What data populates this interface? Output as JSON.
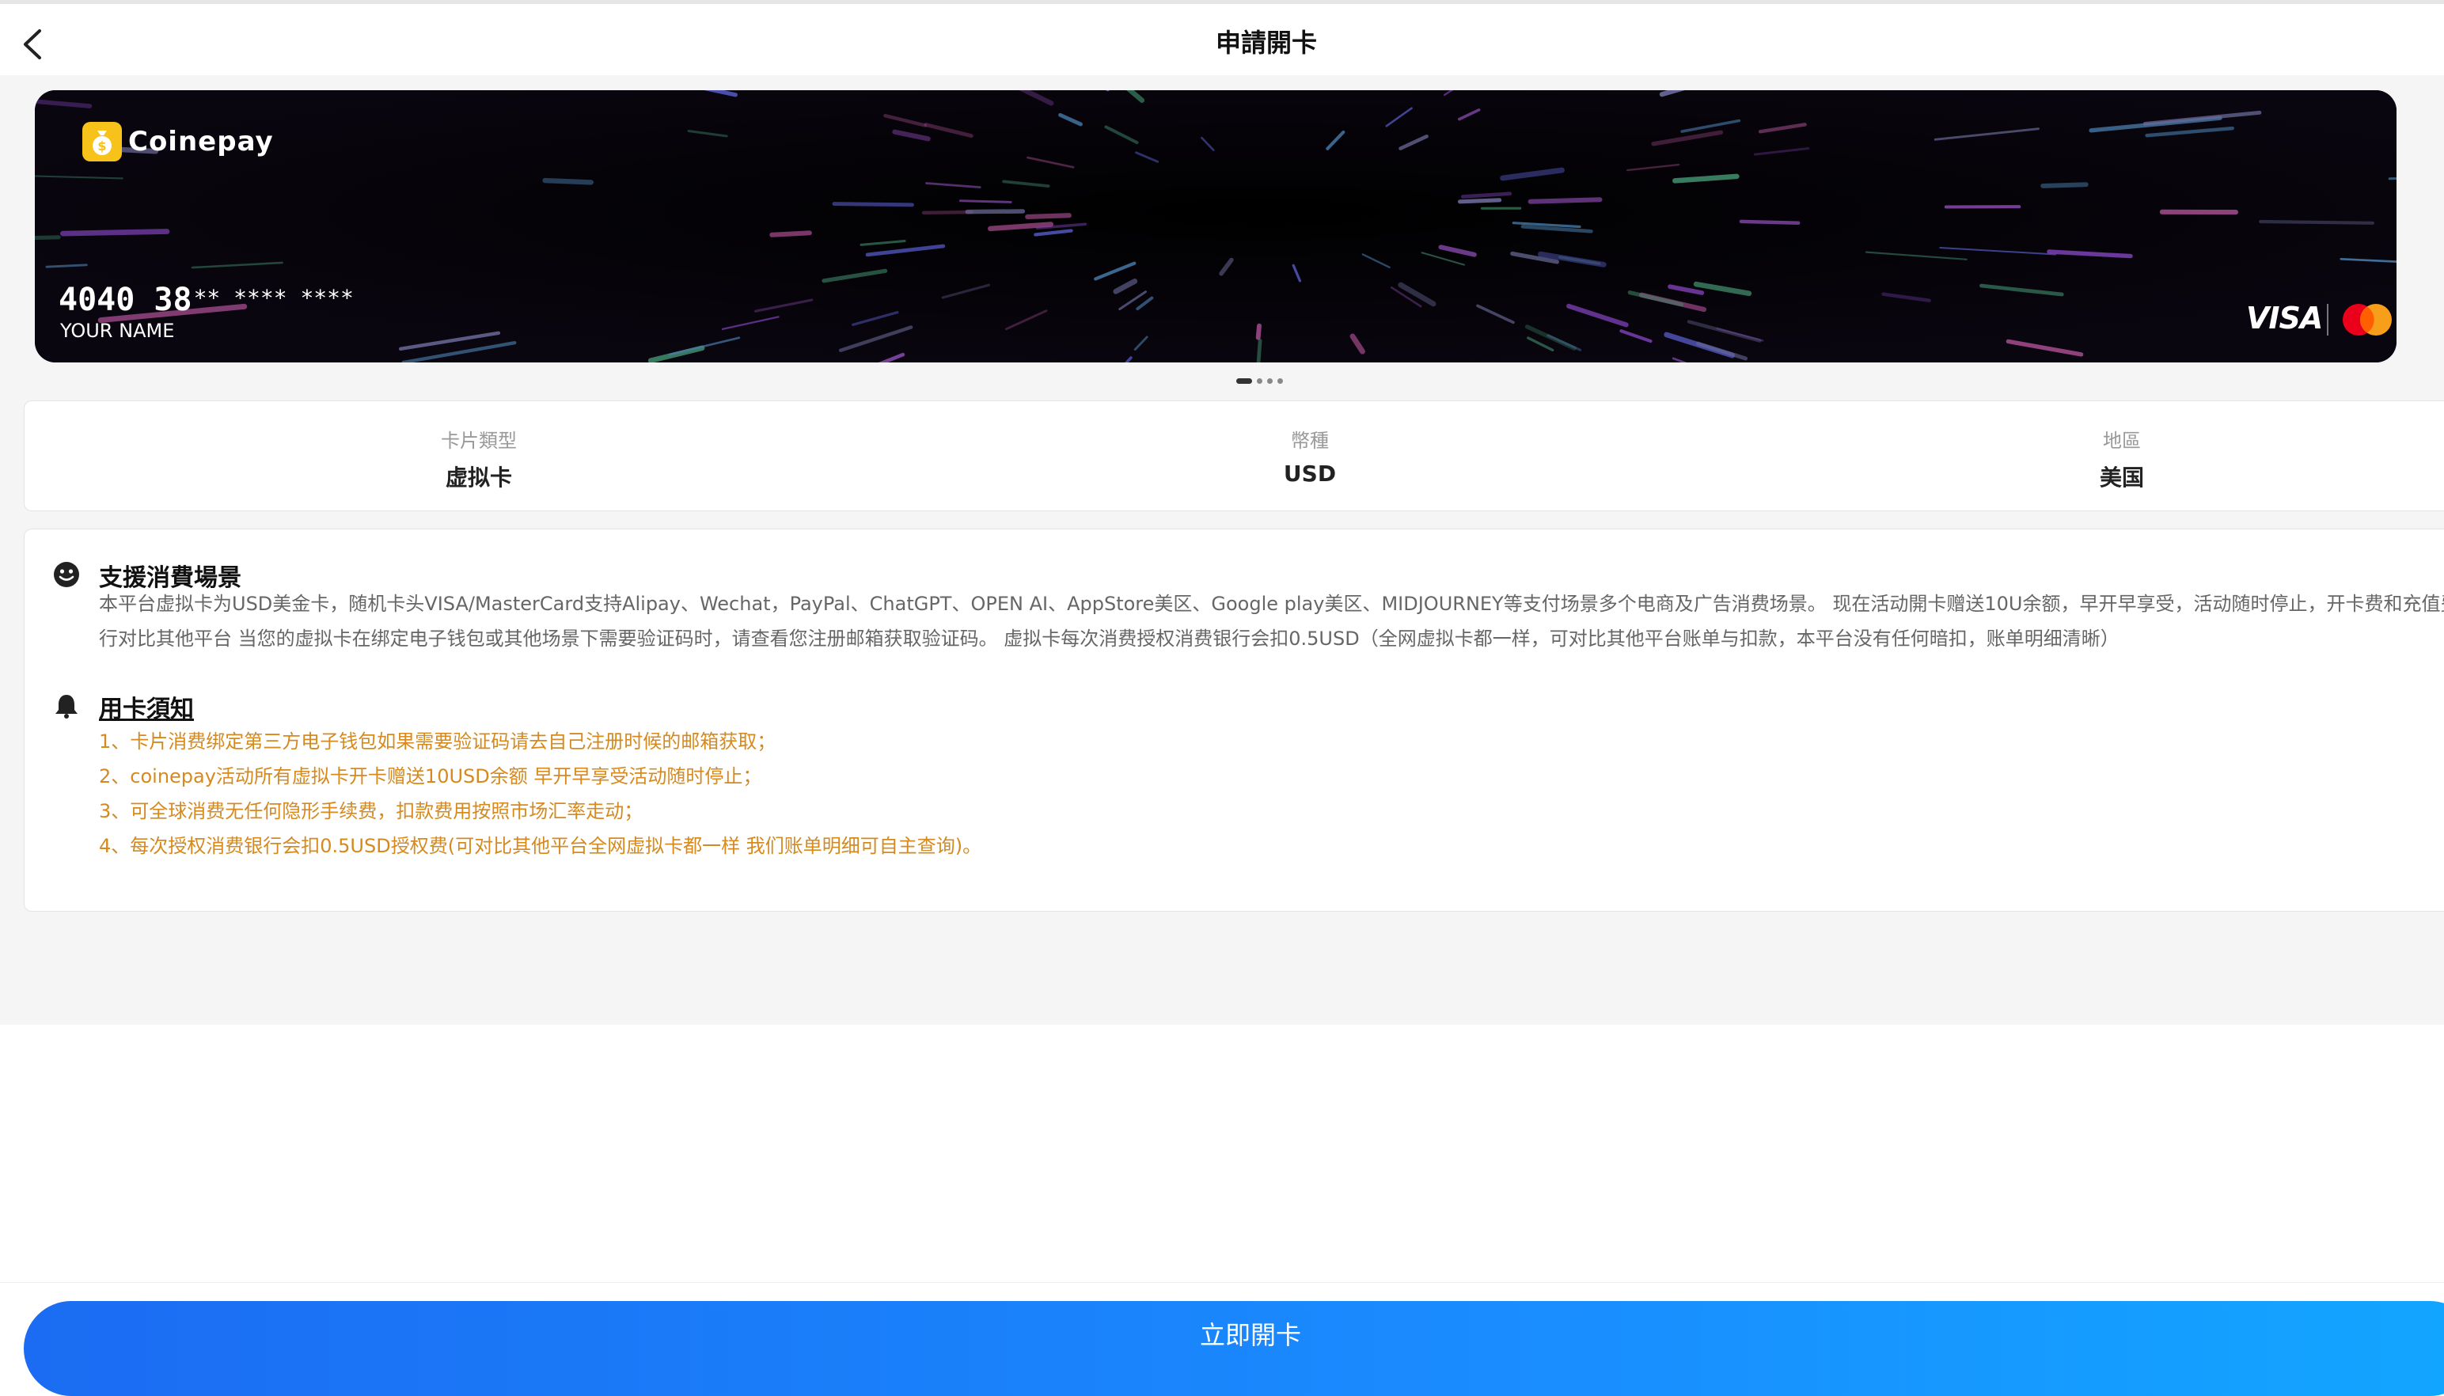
{
  "header": {
    "title": "申請開卡"
  },
  "card": {
    "brand": "Coinepay",
    "number_prefix": "4040 38",
    "number_masked": "** **** ****",
    "holder": "YOUR NAME",
    "network": "VISA"
  },
  "carousel": {
    "pages": 4,
    "active": 0
  },
  "info": {
    "items": [
      {
        "label": "卡片類型",
        "value": "虚拟卡"
      },
      {
        "label": "幣種",
        "value": "USD"
      },
      {
        "label": "地區",
        "value": "美国"
      }
    ]
  },
  "scenes": {
    "title": "支援消費場景",
    "line1": "本平台虚拟卡为USD美金卡，随机卡头VISA/MasterCard支持Alipay、Wechat，PayPal、ChatGPT、OPEN AI、AppStore美区、Google play美区、MIDJOURNEY等支付场景多个电商及广告消费场景。 现在活动開卡赠送10U余额，早开早享受，活动随时停止，开卡费和充值费，可",
    "line2": "行对比其他平台 当您的虚拟卡在绑定电子钱包或其他场景下需要验证码时，请查看您注册邮箱获取验证码。 虚拟卡每次消费授权消费银行会扣0.5USD（全网虚拟卡都一样，可对比其他平台账单与扣款，本平台没有任何暗扣，账单明细清晰）"
  },
  "notice": {
    "title": "用卡須知",
    "items": [
      "1、卡片消费绑定第三方电子钱包如果需要验证码请去自己注册时候的邮箱获取；",
      "2、coinepay活动所有虚拟卡开卡赠送10USD余额 早开早享受活动随时停止；",
      "3、可全球消费无任何隐形手续费，扣款费用按照市场汇率走动；",
      "4、每次授权消费银行会扣0.5USD授权费(可对比其他平台全网虚拟卡都一样 我们账单明细可自主查询)。"
    ]
  },
  "submit": {
    "label": "立即開卡"
  },
  "colors": {
    "primary": "#1a8cff",
    "notice": "#d68a1e",
    "logo": "#f7c21a"
  }
}
